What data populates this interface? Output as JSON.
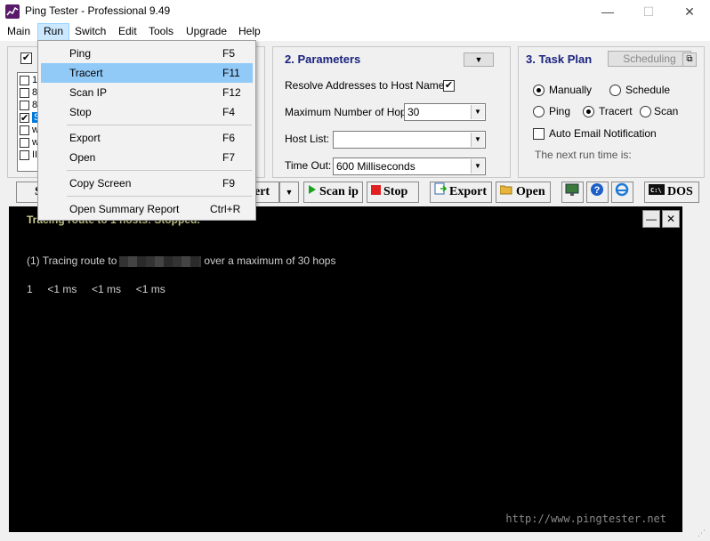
{
  "window": {
    "title": "Ping Tester - Professional  9.49",
    "minimize_glyph": "—",
    "maximize_glyph": "☐",
    "close_glyph": "✕"
  },
  "menubar": {
    "items": [
      "Main",
      "Run",
      "Switch",
      "Edit",
      "Tools",
      "Upgrade",
      "Help"
    ]
  },
  "run_menu": {
    "items": [
      {
        "label": "Ping",
        "shortcut": "F5"
      },
      {
        "label": "Tracert",
        "shortcut": "F11"
      },
      {
        "label": "Scan IP",
        "shortcut": "F12"
      },
      {
        "label": "Stop",
        "shortcut": "F4"
      },
      {
        "label": "Export",
        "shortcut": "F6"
      },
      {
        "label": "Open",
        "shortcut": "F7"
      },
      {
        "label": "Copy Screen",
        "shortcut": "F9"
      },
      {
        "label": "Open Summary Report",
        "shortcut": "Ctrl+R"
      }
    ]
  },
  "hosts": {
    "checks": [
      "✔",
      "",
      "",
      "",
      "✔",
      "",
      "",
      ""
    ],
    "rows": [
      "1",
      "8",
      "8",
      "",
      "S",
      "w",
      "w",
      "II"
    ]
  },
  "parameters": {
    "title": "2. Parameters",
    "resolve_label": "Resolve Addresses to Host Names:",
    "resolve_check": "✔",
    "hops_label": "Maximum Number of Hops:",
    "hops_value": "30",
    "host_list_label": "Host List:",
    "host_list_value": "",
    "timeout_label": "Time Out:",
    "timeout_value": "600  Milliseconds"
  },
  "task_plan": {
    "title": "3. Task Plan",
    "scheduling_label": "Scheduling",
    "manually": "Manually",
    "schedule": "Schedule",
    "ping": "Ping",
    "tracert": "Tracert",
    "scan": "Scan",
    "email_label": "Auto Email Notification",
    "next_run": "The next run time is:"
  },
  "toolbar": {
    "start_fragment": "S",
    "tracert_fragment": "ert",
    "scan_ip": "Scan ip",
    "stop": "Stop",
    "export": "Export",
    "open": "Open",
    "dos": "DOS"
  },
  "console": {
    "status": "Tracing route to 1 hosts:        Stopped.",
    "trace_prefix": "(1) Tracing route to",
    "trace_suffix": "over a maximum of 30 hops",
    "hop_line": "1     <1 ms     <1 ms     <1 ms",
    "url": "http://www.pingtester.net",
    "min_glyph": "—",
    "close_glyph": "✕"
  },
  "colors": {
    "section_title": "#1a237e",
    "menu_highlight": "#91c9f7",
    "console_bg": "#000000"
  }
}
